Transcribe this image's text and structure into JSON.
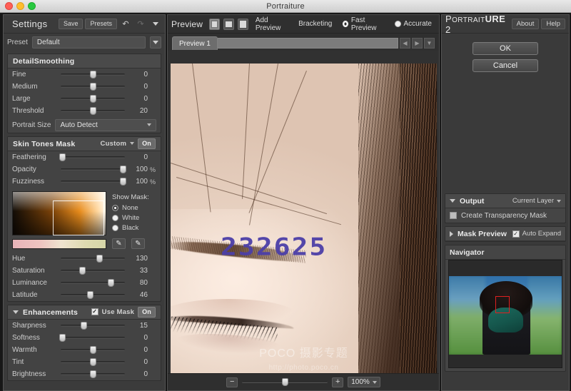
{
  "window": {
    "title": "Portraiture",
    "traffic_lights": [
      "close",
      "minimize",
      "zoom"
    ]
  },
  "settings": {
    "title": "Settings",
    "save_label": "Save",
    "presets_label": "Presets",
    "undo_icon": "undo-arrow-icon",
    "redo_icon": "redo-arrow-icon",
    "menu_icon": "chevron-down-icon",
    "preset_label": "Preset",
    "preset_value": "Default",
    "detail_smoothing": {
      "title": "DetailSmoothing",
      "sliders": [
        {
          "name": "Fine",
          "value": "0",
          "pct": 50
        },
        {
          "name": "Medium",
          "value": "0",
          "pct": 50
        },
        {
          "name": "Large",
          "value": "0",
          "pct": 50
        },
        {
          "name": "Threshold",
          "value": "20",
          "pct": 50
        }
      ],
      "portrait_size_label": "Portrait Size",
      "portrait_size_value": "Auto Detect"
    },
    "skin_tones_mask": {
      "title": "Skin Tones Mask",
      "mode": "Custom",
      "toggle": "On",
      "sliders": [
        {
          "name": "Feathering",
          "value": "0",
          "unit": "",
          "pct": 2
        },
        {
          "name": "Opacity",
          "value": "100",
          "unit": "%",
          "pct": 97
        },
        {
          "name": "Fuzziness",
          "value": "100",
          "unit": "%",
          "pct": 97
        }
      ],
      "show_mask_label": "Show Mask:",
      "show_mask_options": [
        {
          "label": "None",
          "selected": true
        },
        {
          "label": "White",
          "selected": false
        },
        {
          "label": "Black",
          "selected": false
        }
      ],
      "eyedropper_plus_icon": "eyedropper-plus-icon",
      "eyedropper_minus_icon": "eyedropper-minus-icon",
      "tone_sliders": [
        {
          "name": "Hue",
          "value": "130",
          "pct": 60
        },
        {
          "name": "Saturation",
          "value": "33",
          "pct": 33
        },
        {
          "name": "Luminance",
          "value": "80",
          "pct": 78
        },
        {
          "name": "Latitude",
          "value": "46",
          "pct": 46
        }
      ]
    },
    "enhancements": {
      "title": "Enhancements",
      "use_mask_label": "Use Mask",
      "use_mask_checked": true,
      "toggle": "On",
      "sliders": [
        {
          "name": "Sharpness",
          "value": "15",
          "pct": 35
        },
        {
          "name": "Softness",
          "value": "0",
          "pct": 2
        },
        {
          "name": "Warmth",
          "value": "0",
          "pct": 50
        },
        {
          "name": "Tint",
          "value": "0",
          "pct": 50
        },
        {
          "name": "Brightness",
          "value": "0",
          "pct": 50
        }
      ]
    }
  },
  "preview": {
    "title": "Preview",
    "view_modes": [
      {
        "name": "single-view",
        "active": true
      },
      {
        "name": "split-horizontal-view",
        "active": false
      },
      {
        "name": "split-vertical-view",
        "active": false
      }
    ],
    "add_preview_label": "Add Preview",
    "bracketing_label": "Bracketing",
    "quality_options": [
      {
        "label": "Fast Preview",
        "selected": true
      },
      {
        "label": "Accurate",
        "selected": false
      }
    ],
    "tab_label": "Preview 1",
    "prev_icon": "chevron-left-icon",
    "next_icon": "chevron-right-icon",
    "dropdown_icon": "chevron-down-icon",
    "watermark_number": "232625",
    "watermark_brand": "POCO 摄影专题",
    "watermark_url": "http://photo.poco.cn",
    "zoom_out_label": "−",
    "zoom_in_label": "+",
    "zoom_level": "100%",
    "zoom_slider_pct": 50
  },
  "portraiture": {
    "brand_prefix": "P",
    "brand_small": "ORTRAIT",
    "brand_bold": "URE",
    "brand_version": "2",
    "about_label": "About",
    "help_label": "Help",
    "ok_label": "OK",
    "cancel_label": "Cancel",
    "output": {
      "title": "Output",
      "target": "Current Layer",
      "transparency_label": "Create Transparency Mask",
      "transparency_checked": false
    },
    "mask_preview": {
      "title": "Mask Preview",
      "auto_expand_label": "Auto Expand",
      "auto_expand_checked": true
    },
    "navigator": {
      "title": "Navigator"
    }
  },
  "colors": {
    "panel_bg": "#3b3b3b",
    "group_bg": "#434343",
    "text": "#cdcdcd",
    "accent_watermark": "#4c3fa8",
    "nav_rect": "#e02020"
  }
}
